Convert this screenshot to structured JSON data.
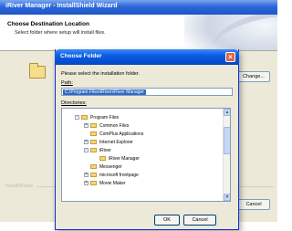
{
  "wizard": {
    "title": "iRiver Manager - InstallShield Wizard",
    "heading": "Choose Destination Location",
    "subheading": "Select folder where setup will install files.",
    "change_label": "Change...",
    "cancel_label": "Cancel",
    "installshield_label": "InstallShield"
  },
  "dialog": {
    "title": "Choose Folder",
    "close_glyph": "×",
    "prompt": "Please select the installation folder.",
    "path_label": "Path:",
    "path_value": "C:\\Program Files\\iRiver\\iRiver Manager",
    "directories_label": "Directories:",
    "tree": [
      {
        "label": "Program Files",
        "expander": "-"
      },
      {
        "label": "Common Files",
        "expander": "+"
      },
      {
        "label": "ComPlus Applications",
        "expander": ""
      },
      {
        "label": "Internet Explorer",
        "expander": "+"
      },
      {
        "label": "iRiver",
        "expander": "-"
      },
      {
        "label": "iRiver Manager",
        "expander": ""
      },
      {
        "label": "Messenger",
        "expander": ""
      },
      {
        "label": "microsoft frontpage",
        "expander": "+"
      },
      {
        "label": "Movie Maker",
        "expander": "+"
      }
    ],
    "ok_label": "OK",
    "cancel_label": "Cancel"
  },
  "icons": {
    "folder": "folder-icon",
    "close": "close-icon",
    "scroll_up": "scroll-up-icon",
    "scroll_down": "scroll-down-icon"
  }
}
